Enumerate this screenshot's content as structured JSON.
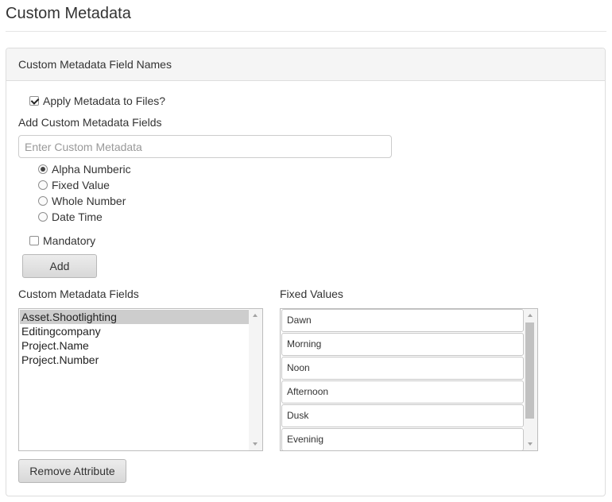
{
  "page": {
    "title": "Custom Metadata"
  },
  "panel": {
    "heading": "Custom Metadata Field Names",
    "apply_label": "Apply Metadata to Files?",
    "apply_checked": true,
    "add_fields_label": "Add Custom Metadata Fields",
    "input": {
      "placeholder": "Enter Custom Metadata",
      "value": ""
    },
    "types": [
      {
        "label": "Alpha Numberic",
        "selected": true
      },
      {
        "label": "Fixed Value",
        "selected": false
      },
      {
        "label": "Whole Number",
        "selected": false
      },
      {
        "label": "Date Time",
        "selected": false
      }
    ],
    "mandatory_label": "Mandatory",
    "mandatory_checked": false,
    "add_button": "Add",
    "fields_label": "Custom Metadata Fields",
    "fields": [
      {
        "label": "Asset.Shootlighting",
        "selected": true
      },
      {
        "label": "Editingcompany",
        "selected": false
      },
      {
        "label": "Project.Name",
        "selected": false
      },
      {
        "label": "Project.Number",
        "selected": false
      }
    ],
    "fixed_values_label": "Fixed Values",
    "fixed_values": [
      "Dawn",
      "Morning",
      "Noon",
      "Afternoon",
      "Dusk",
      "Eveninig"
    ],
    "remove_button": "Remove Attribute"
  }
}
